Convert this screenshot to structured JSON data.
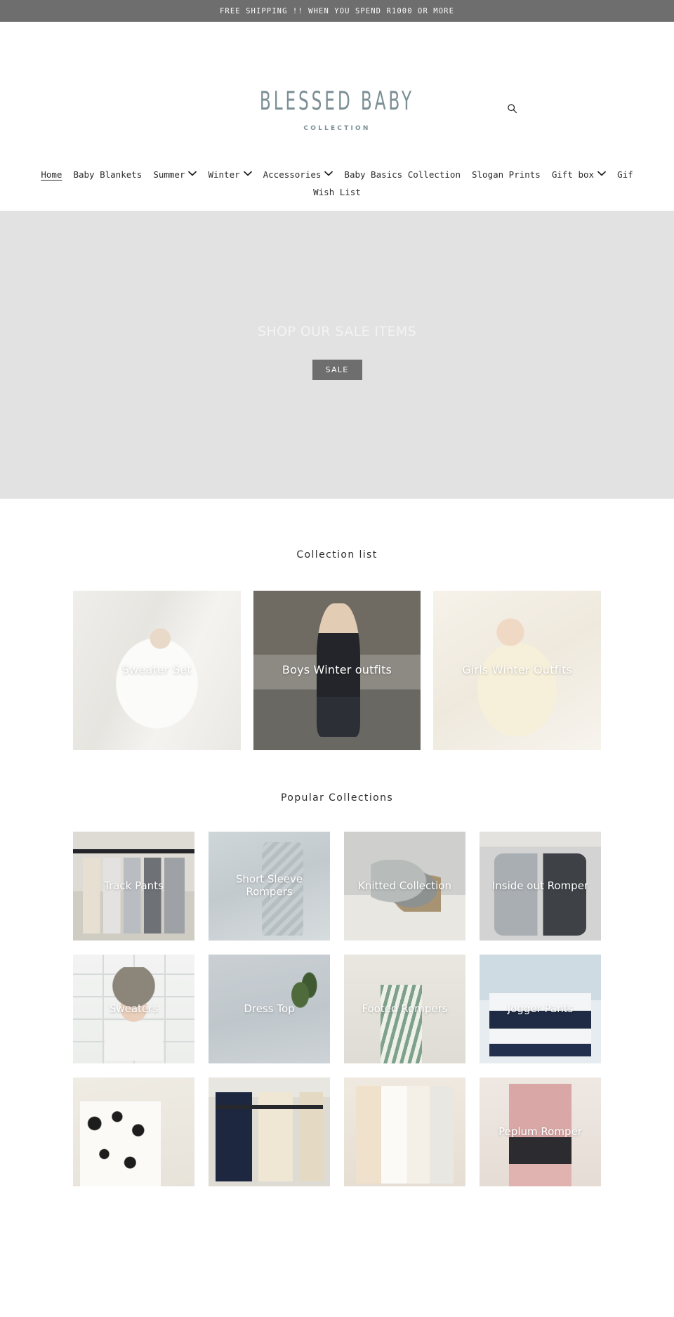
{
  "announcement": {
    "text": "FREE SHIPPING !! WHEN YOU SPEND R1000 OR MORE",
    "background": "#6e6e6e",
    "color": "#ffffff"
  },
  "header": {
    "logo_main": "BLESSED BABY",
    "logo_sub": "COLLECTION",
    "logo_color": "#7b8f95",
    "search_icon": "search-icon"
  },
  "nav": {
    "items": [
      {
        "label": "Home",
        "active": true,
        "has_dropdown": false
      },
      {
        "label": "Baby Blankets",
        "active": false,
        "has_dropdown": false
      },
      {
        "label": "Summer",
        "active": false,
        "has_dropdown": true
      },
      {
        "label": "Winter",
        "active": false,
        "has_dropdown": true
      },
      {
        "label": "Accessories",
        "active": false,
        "has_dropdown": true
      },
      {
        "label": "Baby Basics Collection",
        "active": false,
        "has_dropdown": false
      },
      {
        "label": "Slogan Prints",
        "active": false,
        "has_dropdown": false
      },
      {
        "label": "Gift box",
        "active": false,
        "has_dropdown": true
      },
      {
        "label": "Gif",
        "active": false,
        "has_dropdown": false
      },
      {
        "label": "Wish List",
        "active": false,
        "has_dropdown": false
      }
    ]
  },
  "hero": {
    "title": "SHOP OUR SALE ITEMS",
    "button_label": "SALE",
    "background": "#e2e2e2",
    "button_background": "#6e6e6e"
  },
  "collection_list": {
    "title": "Collection list",
    "cards": [
      {
        "label": "Sweater Set",
        "photo": "ph-sweaterset"
      },
      {
        "label": "Boys Winter outfits",
        "photo": "ph-boys"
      },
      {
        "label": "Girls Winter Outfits",
        "photo": "ph-girls"
      }
    ]
  },
  "popular_collections": {
    "title": "Popular Collections",
    "tiles": [
      {
        "label": "Track Pants",
        "photo": "ph-rail ph-track"
      },
      {
        "label": "Short Sleeve Rompers",
        "photo": "ph-shortsleeve"
      },
      {
        "label": "Knitted Collection",
        "photo": "ph-knitted"
      },
      {
        "label": "Inside out Romper",
        "photo": "ph-insideout"
      },
      {
        "label": "Sweaters",
        "photo": "ph-sweaters"
      },
      {
        "label": "Dress Top",
        "photo": "ph-dresstop"
      },
      {
        "label": "Footed Rompers",
        "photo": "ph-footed"
      },
      {
        "label": "Jogger Pants",
        "photo": "ph-jogger"
      },
      {
        "label": "",
        "photo": "ph-crossknit"
      },
      {
        "label": "",
        "photo": "ph-rackdark"
      },
      {
        "label": "",
        "photo": "ph-swaddle"
      },
      {
        "label": "Peplum Romper",
        "photo": "ph-pink"
      }
    ]
  }
}
